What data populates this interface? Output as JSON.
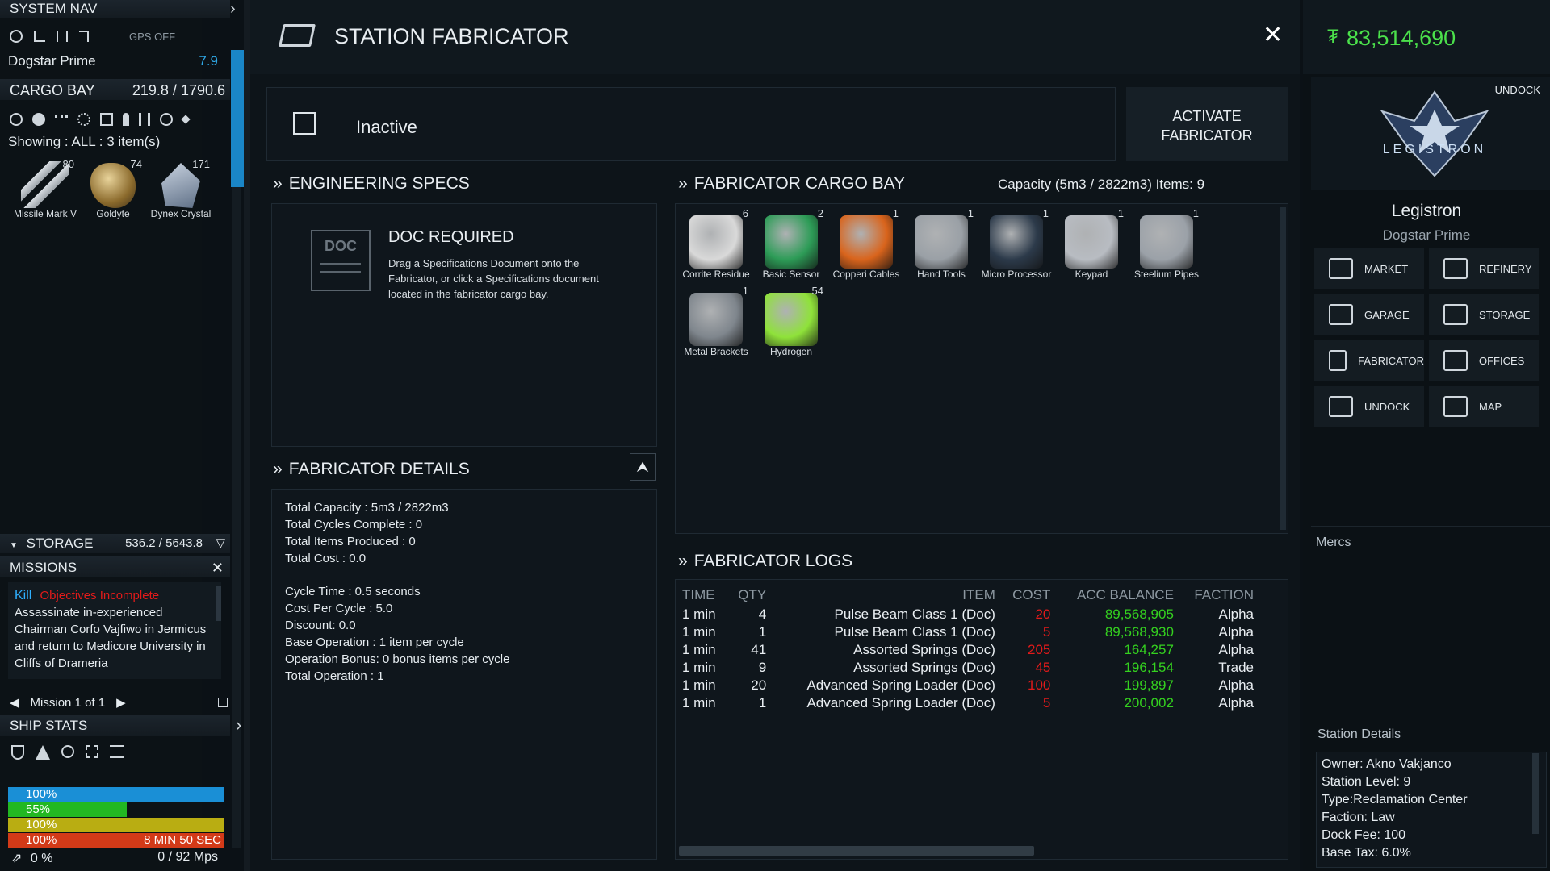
{
  "left": {
    "system_nav_title": "SYSTEM NAV",
    "gps_status": "GPS OFF",
    "location": "Dogstar Prime",
    "location_value": "7.9",
    "cargo_title": "CARGO BAY",
    "cargo_value": "219.8 / 1790.6",
    "showing": "Showing : ALL : 3 item(s)",
    "cargo_items": [
      {
        "name": "Missile Mark V",
        "count": "80",
        "icon": "missile-icon"
      },
      {
        "name": "Goldyte",
        "count": "74",
        "icon": "ore-icon"
      },
      {
        "name": "Dynex Crystal",
        "count": "171",
        "icon": "crystal-icon"
      }
    ],
    "storage_title": "STORAGE",
    "storage_value": "536.2 / 5643.8",
    "missions_title": "MISSIONS",
    "mission_tag": "Kill",
    "mission_status": "Objectives Incomplete",
    "mission_text": "Assassinate in-experienced Chairman Corfo Vajfiwo in Jermicus and return to Medicore University in Cliffs of Drameria",
    "mission_pager": "Mission 1 of 1",
    "ship_stats_title": "SHIP STATS",
    "stats": [
      {
        "label": "100%",
        "fill": 1.0,
        "color": "#1a8fd6",
        "extra": ""
      },
      {
        "label": "55%",
        "fill": 0.55,
        "color": "#22b822",
        "extra": ""
      },
      {
        "label": "100%",
        "fill": 1.0,
        "color": "#b9ad12",
        "extra": ""
      },
      {
        "label": "100%",
        "fill": 1.0,
        "color": "#d33a18",
        "extra": "8 MIN 50 SEC"
      }
    ],
    "speed_label": "0 %",
    "speed_value": "0  /  92 Mps"
  },
  "center": {
    "title": "STATION FABRICATOR",
    "status": "Inactive",
    "activate_line1": "ACTIVATE",
    "activate_line2": "FABRICATOR",
    "specs_title": "ENGINEERING SPECS",
    "doc_icon_label": "DOC",
    "doc_title": "DOC REQUIRED",
    "doc_text": "Drag a Specifications Document onto the Fabricator, or click a Specifications document located in the fabricator cargo bay.",
    "cargo_title": "FABRICATOR CARGO BAY",
    "cargo_capacity": "Capacity (5m3 / 2822m3) Items: 9",
    "fab_items": [
      {
        "name": "Corrite Residue",
        "count": "6",
        "color": "#d9d9d9"
      },
      {
        "name": "Basic Sensor",
        "count": "2",
        "color": "#2d9c57"
      },
      {
        "name": "Copperi Cables",
        "count": "1",
        "color": "#d9641c"
      },
      {
        "name": "Hand Tools",
        "count": "1",
        "color": "#9aa0a6"
      },
      {
        "name": "Micro Processor",
        "count": "1",
        "color": "#2c3a4a"
      },
      {
        "name": "Keypad",
        "count": "1",
        "color": "#b8bcc2"
      },
      {
        "name": "Steelium Pipes",
        "count": "1",
        "color": "#9ba1a8"
      },
      {
        "name": "Metal Brackets",
        "count": "1",
        "color": "#7f868d"
      },
      {
        "name": "Hydrogen",
        "count": "54",
        "color": "#8fe23a"
      }
    ],
    "details_title": "FABRICATOR DETAILS",
    "details_a": [
      "Total Capacity : 5m3 / 2822m3",
      "Total Cycles Complete : 0",
      "Total Items Produced : 0",
      "Total Cost : 0.0"
    ],
    "details_b": [
      "Cycle Time : 0.5 seconds",
      "Cost Per Cycle : 5.0",
      "Discount: 0.0",
      "Base Operation : 1 item per cycle",
      "Operation Bonus: 0 bonus items per cycle",
      "Total Operation : 1"
    ],
    "logs_title": "FABRICATOR LOGS",
    "log_headers": [
      "TIME",
      "QTY",
      "ITEM",
      "COST",
      "ACC BALANCE",
      "FACTION"
    ],
    "logs": [
      [
        "1 min",
        "4",
        "Pulse Beam Class 1 (Doc)",
        "20",
        "89,568,905",
        "Alpha"
      ],
      [
        "1 min",
        "1",
        "Pulse Beam Class 1 (Doc)",
        "5",
        "89,568,930",
        "Alpha"
      ],
      [
        "1 min",
        "41",
        "Assorted Springs (Doc)",
        "205",
        "164,257",
        "Alpha"
      ],
      [
        "1 min",
        "9",
        "Assorted Springs (Doc)",
        "45",
        "196,154",
        "Trade"
      ],
      [
        "1 min",
        "20",
        "Advanced Spring Loader (Doc)",
        "100",
        "199,897",
        "Alpha"
      ],
      [
        "1 min",
        "1",
        "Advanced Spring Loader (Doc)",
        "5",
        "200,002",
        "Alpha"
      ]
    ]
  },
  "right": {
    "credits": "83,514,690",
    "credit_symbol": "₮",
    "undock_top": "UNDOCK",
    "logo_text": "LEGISTRON",
    "station_name": "Legistron",
    "station_system": "Dogstar Prime",
    "nav": [
      {
        "label": "MARKET",
        "icon": "market-icon"
      },
      {
        "label": "REFINERY",
        "icon": "refinery-icon"
      },
      {
        "label": "GARAGE",
        "icon": "garage-icon"
      },
      {
        "label": "STORAGE",
        "icon": "storage-icon"
      },
      {
        "label": "FABRICATOR",
        "icon": "fabricator-icon"
      },
      {
        "label": "OFFICES",
        "icon": "offices-icon"
      },
      {
        "label": "UNDOCK",
        "icon": "undock-icon"
      },
      {
        "label": "MAP",
        "icon": "map-icon"
      }
    ],
    "mercs_title": "Mercs",
    "details_title": "Station Details",
    "details": [
      "Owner: Akno Vakjanco",
      "Station Level: 9",
      "Type:Reclamation Center",
      "Faction: Law",
      "Dock Fee: 100",
      "Base Tax: 6.0%"
    ]
  },
  "colors": {
    "accent": "#1a8fd6",
    "credits": "#4be04b",
    "cost": "#e21a1a",
    "balance": "#34d11f"
  }
}
